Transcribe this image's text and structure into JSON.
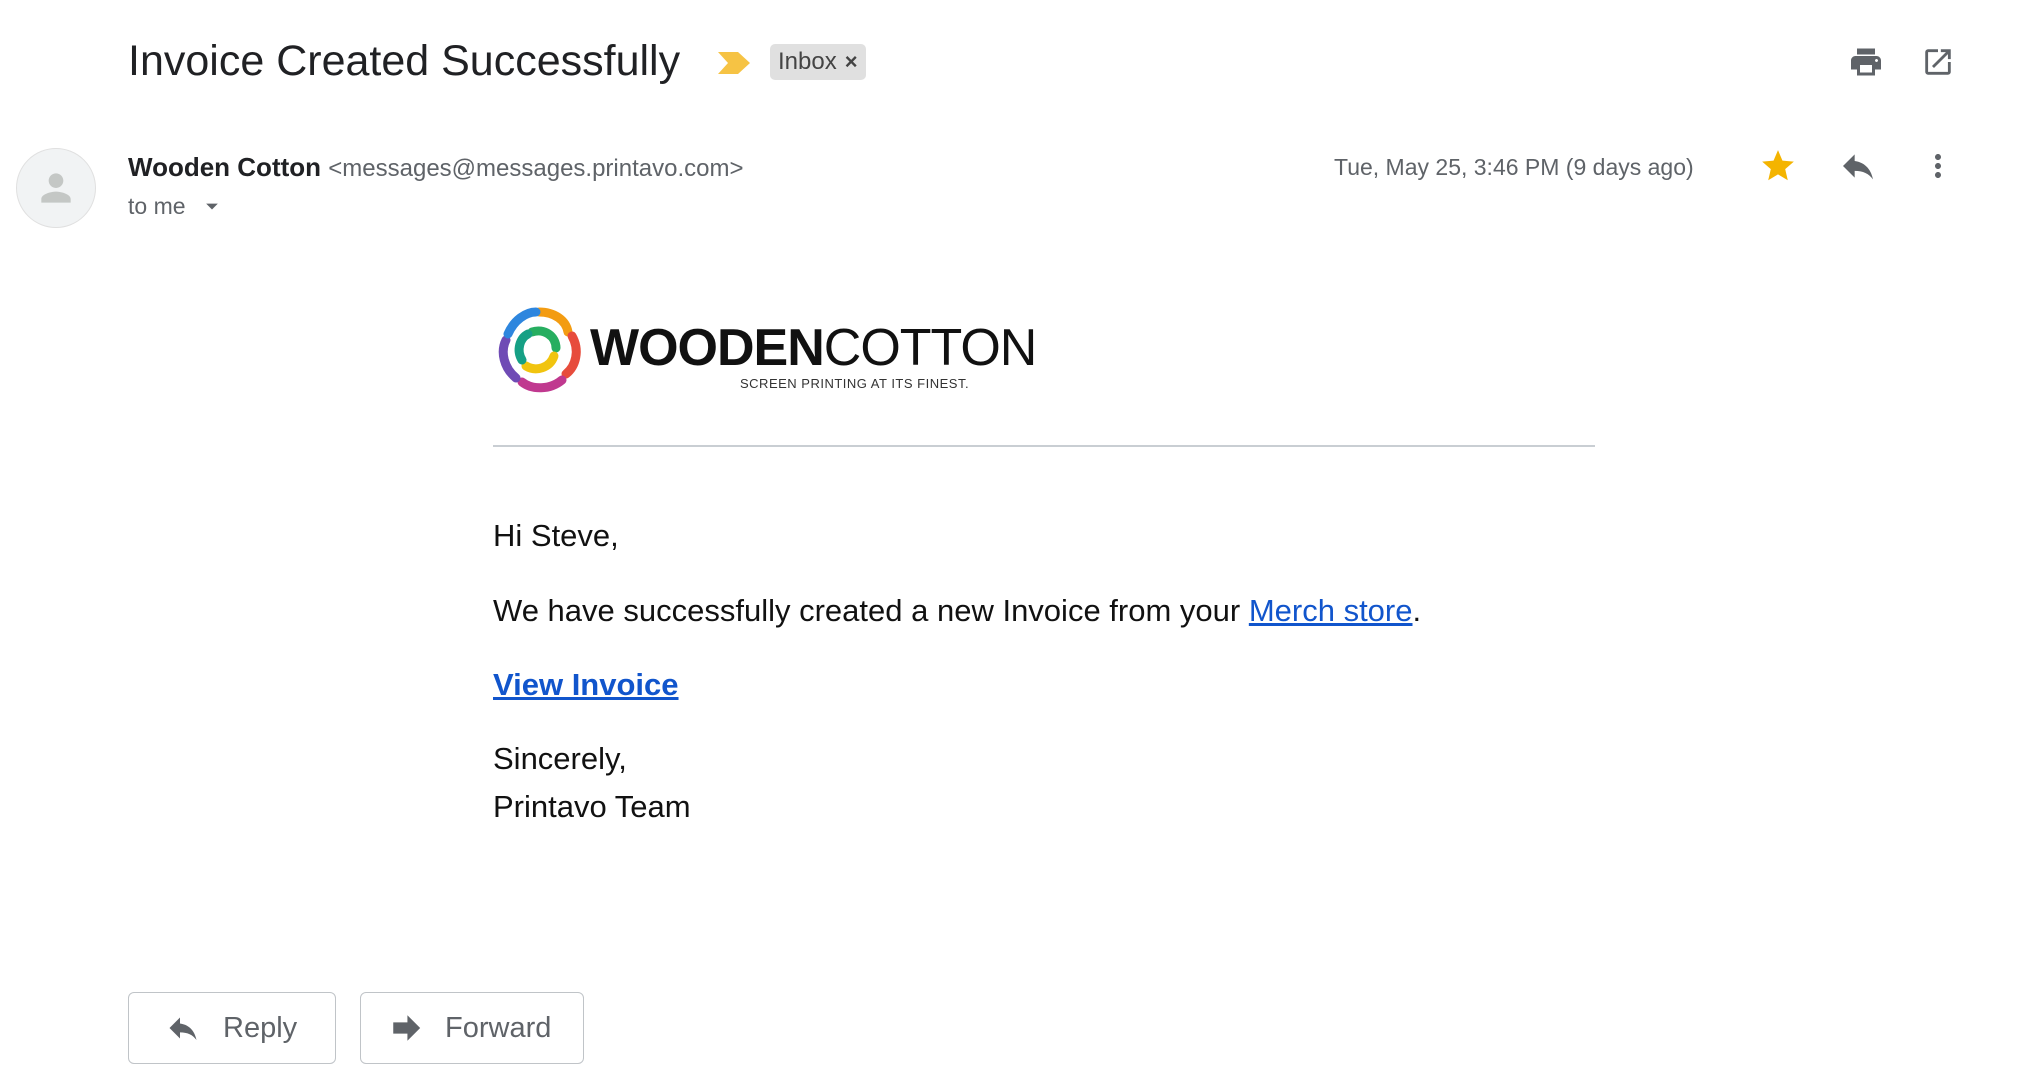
{
  "subject": "Invoice Created Successfully",
  "label": {
    "name": "Inbox",
    "remove": "×"
  },
  "sender": {
    "name": "Wooden Cotton",
    "email": "<messages@messages.printavo.com>",
    "to": "to me"
  },
  "date": "Tue, May 25, 3:46 PM (9 days ago)",
  "logo": {
    "word_bold": "WOODEN",
    "word_light": "COTTON",
    "tagline": "SCREEN PRINTING AT ITS FINEST."
  },
  "body": {
    "greeting": "Hi Steve,",
    "message_prefix": "We have successfully created a new Invoice from your ",
    "message_link": "Merch store",
    "message_suffix": ".",
    "view_invoice": "View Invoice",
    "closing": "Sincerely,",
    "signature": "Printavo Team"
  },
  "actions": {
    "reply": "Reply",
    "forward": "Forward"
  },
  "colors": {
    "link": "#1155cc",
    "star": "#f4b400",
    "importance": "#f6c344",
    "label_bg": "#e0e0e0"
  },
  "icons": [
    "importance-marker-icon",
    "print-icon",
    "open-in-new-window-icon",
    "avatar-icon",
    "dropdown-arrow-icon",
    "star-icon",
    "reply-icon",
    "more-vert-icon",
    "forward-icon",
    "logo-mark-icon"
  ]
}
